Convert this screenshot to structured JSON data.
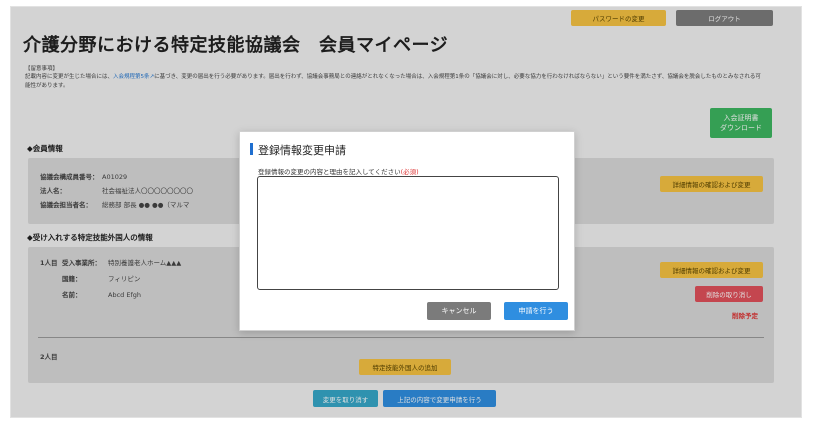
{
  "header": {
    "title": "介護分野における特定技能協議会　会員マイページ",
    "change_password_label": "パスワードの変更",
    "logout_label": "ログアウト"
  },
  "notice": {
    "heading": "【留意事項】",
    "text_before_link": "記載内容に変更が生じた場合には、",
    "link_text": "入会規程第5条",
    "text_after_link": "に基づき、変更の届出を行う必要があります。届出を行わず、協議会事務局との連絡がとれなくなった場合は、入会規程第1条の「協議会に対し、必要な協力を行わなければならない」という要件を満たさず、協議会を脱会したものとみなされる可能性があります。"
  },
  "certificate_button": {
    "line1": "入会証明書",
    "line2": "ダウンロード"
  },
  "member_info": {
    "section_title": "◆会員情報",
    "rows": [
      {
        "label": "協議会構成員番号：",
        "value": "A01029"
      },
      {
        "label": "法人名：",
        "value": "社会福祉法人〇〇〇〇〇〇〇〇"
      },
      {
        "label": "協議会担当者名：",
        "value": "総務部 部長 ●● ●●（マルマ"
      }
    ],
    "detail_button": "詳細情報の確認および変更"
  },
  "foreign_workers": {
    "section_title": "◆受け入れする特定技能外国人の情報",
    "person1": {
      "index": "1人目",
      "facility_label": "受入事業所：",
      "facility_value": "特別養護老人ホーム▲▲▲",
      "country_label": "国籍：",
      "country_value": "フィリピン",
      "name_label": "名前：",
      "name_value": "Abcd Efgh",
      "detail_button": "詳細情報の確認および変更",
      "cancel_delete_button": "削除の取り消し",
      "delete_status": "削除予定"
    },
    "person2": {
      "index": "2人目",
      "add_button": "特定技能外国人の追加"
    }
  },
  "footer_buttons": {
    "revert": "変更を取り消す",
    "apply": "上記の内容で変更申請を行う"
  },
  "modal": {
    "title": "登録情報変更申請",
    "label": "登録情報の変更の内容と理由を記入してください",
    "required": "(必須)",
    "textarea_value": "",
    "cancel_label": "キャンセル",
    "submit_label": "申請を行う"
  },
  "colors": {
    "accent_blue": "#2f8ee0",
    "warning_yellow": "#f5c242",
    "danger_red": "#e0505a",
    "success_green": "#3db560"
  }
}
